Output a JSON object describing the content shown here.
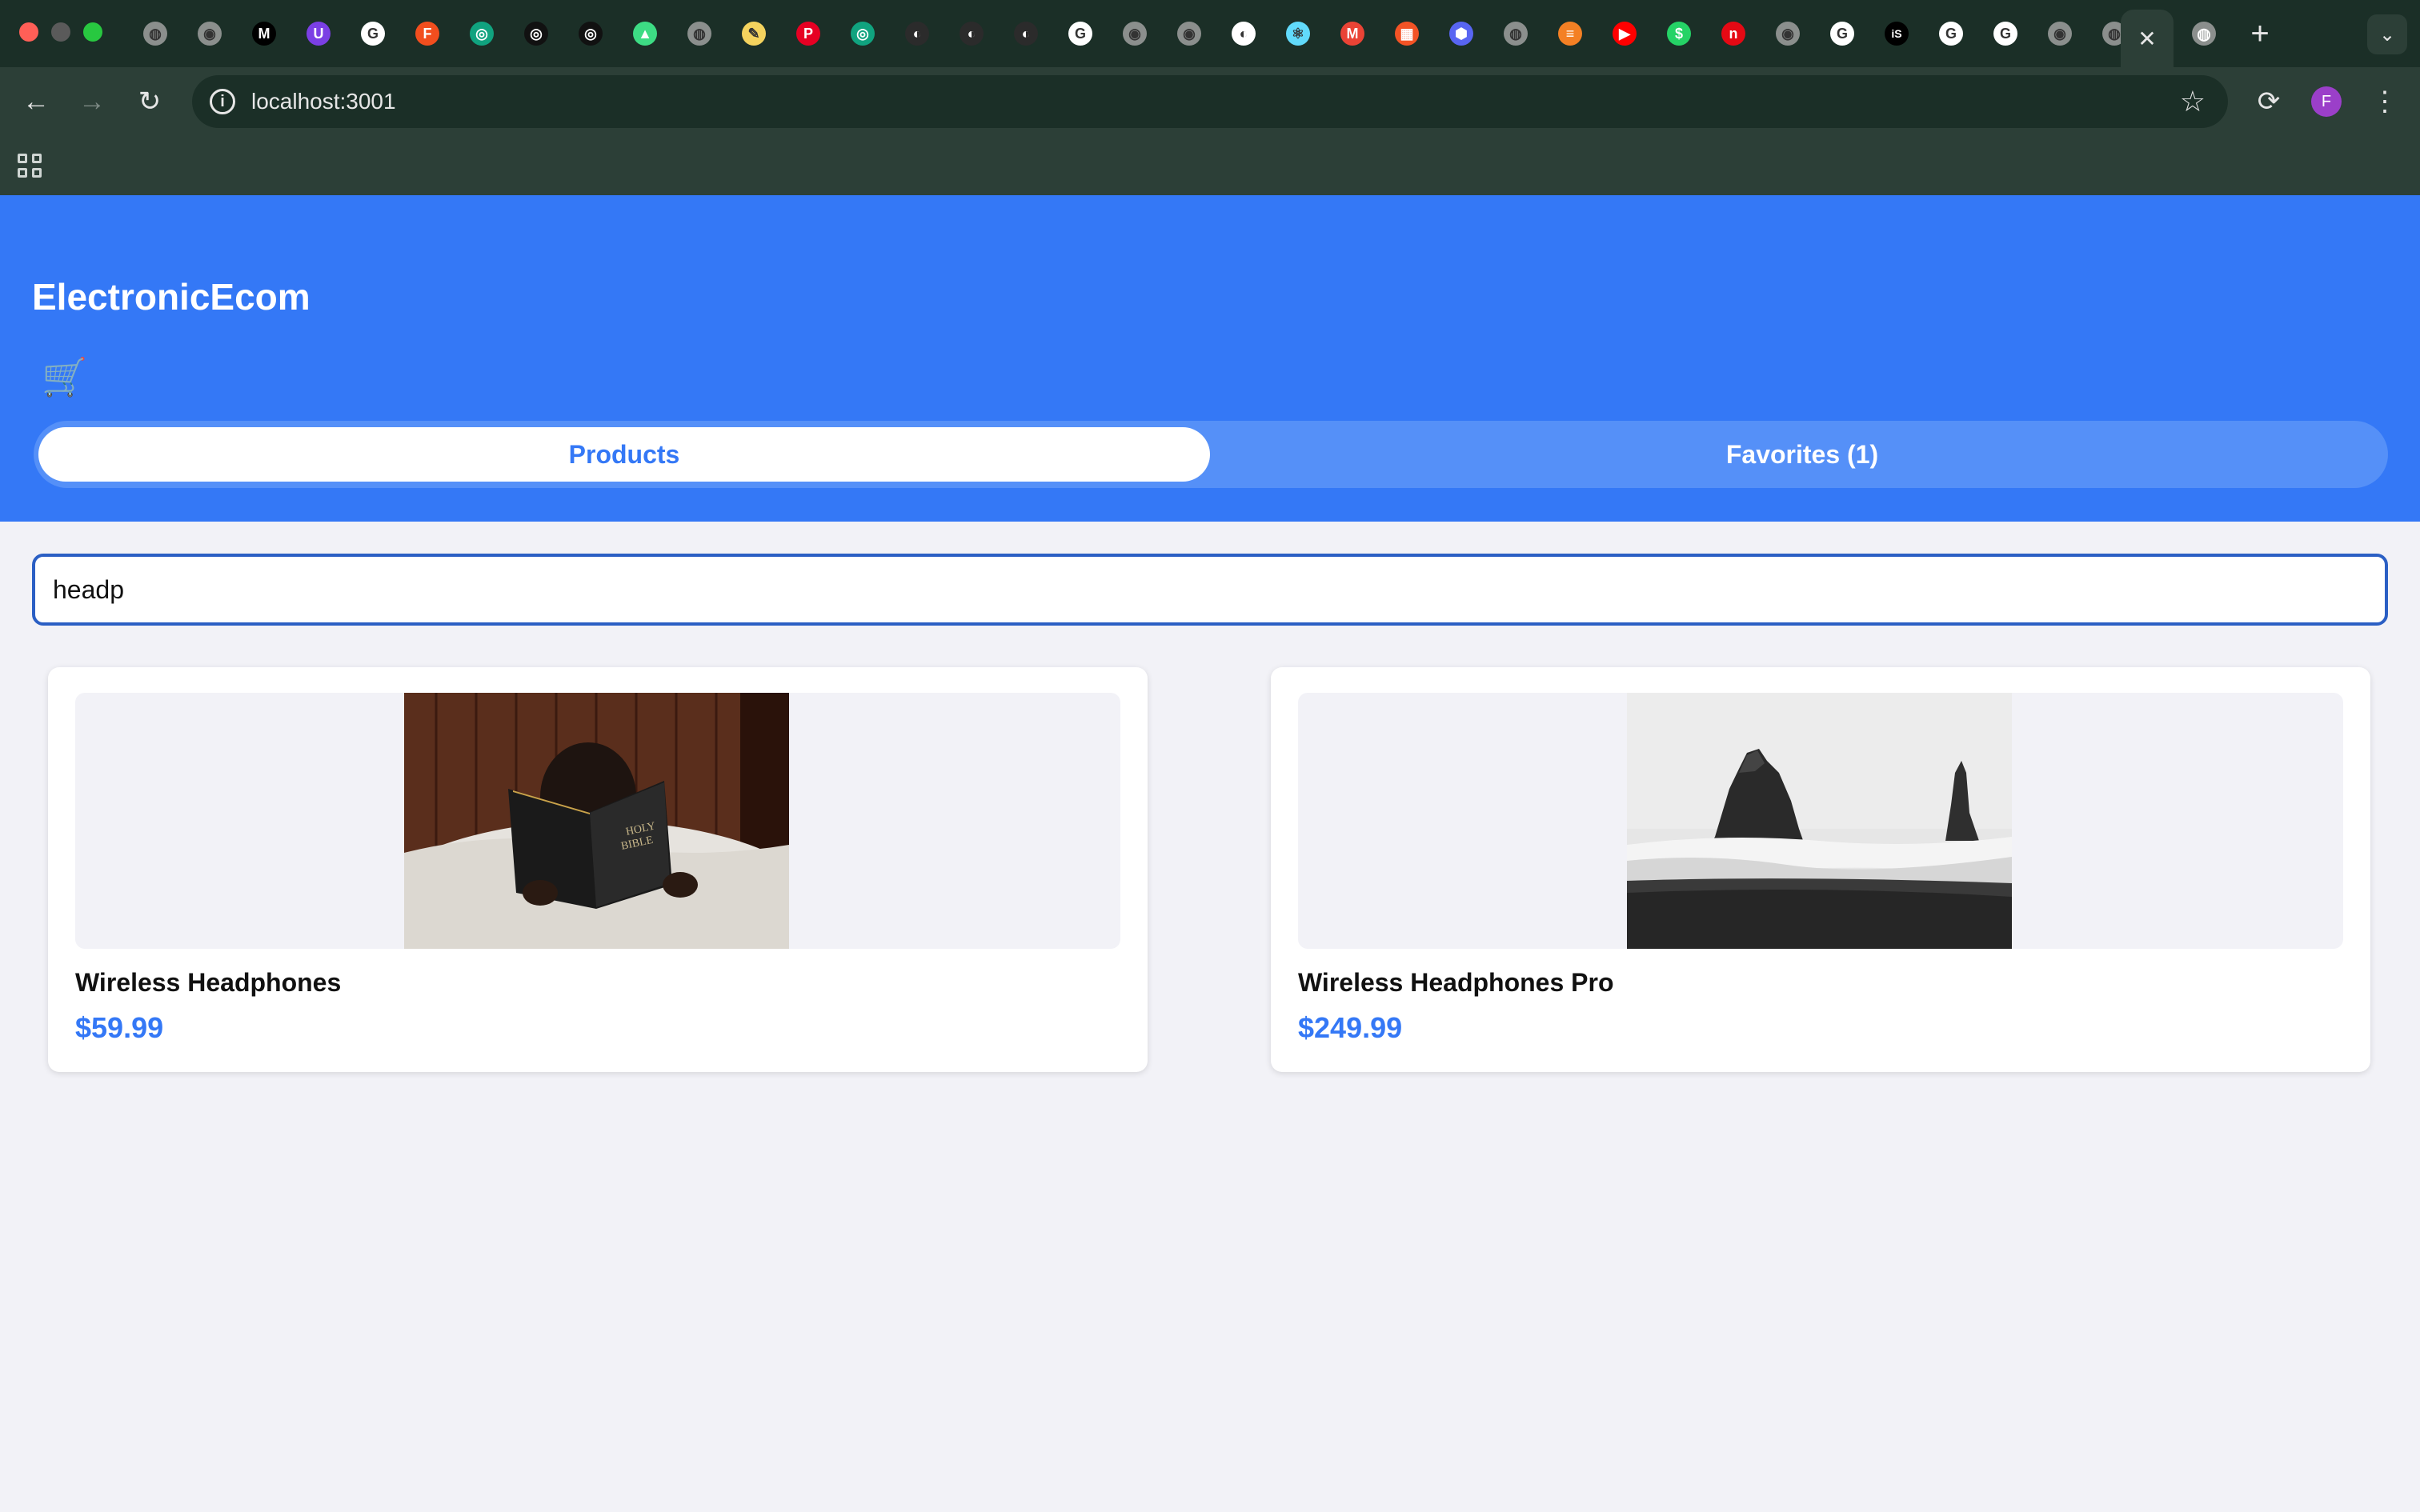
{
  "browser": {
    "url": "localhost:3001",
    "tab_close_glyph": "✕",
    "new_tab_glyph": "+",
    "avatar_initial": "F",
    "tab_favicons": [
      {
        "icon": "globe-icon",
        "glyph": "◍",
        "color": "#8b8f8d"
      },
      {
        "icon": "chrome-icon",
        "glyph": "◉",
        "color": "#8b8f8d"
      },
      {
        "icon": "medium-icon",
        "glyph": "M",
        "color": "#000000"
      },
      {
        "icon": "u-icon",
        "glyph": "U",
        "color": "#7b3fe4"
      },
      {
        "icon": "google-icon",
        "glyph": "G",
        "color": "#ffffff"
      },
      {
        "icon": "figma-icon",
        "glyph": "F",
        "color": "#f24e1e"
      },
      {
        "icon": "openai-icon",
        "glyph": "◎",
        "color": "#10a37f"
      },
      {
        "icon": "openai-icon",
        "glyph": "◎",
        "color": "#111111"
      },
      {
        "icon": "openai-icon",
        "glyph": "◎",
        "color": "#111111"
      },
      {
        "icon": "android-icon",
        "glyph": "▲",
        "color": "#3ddc84"
      },
      {
        "icon": "globe-icon",
        "glyph": "◍",
        "color": "#8b8f8d"
      },
      {
        "icon": "notes-icon",
        "glyph": "✎",
        "color": "#f4d35e"
      },
      {
        "icon": "pinterest-icon",
        "glyph": "P",
        "color": "#e60023"
      },
      {
        "icon": "openai-icon",
        "glyph": "◎",
        "color": "#10a37f"
      },
      {
        "icon": "github-icon",
        "glyph": "◐",
        "color": "#2b2b2b"
      },
      {
        "icon": "github-icon",
        "glyph": "◐",
        "color": "#2b2b2b"
      },
      {
        "icon": "github-icon",
        "glyph": "◐",
        "color": "#2b2b2b"
      },
      {
        "icon": "google-icon",
        "glyph": "G",
        "color": "#ffffff"
      },
      {
        "icon": "chrome-icon",
        "glyph": "◉",
        "color": "#8b8f8d"
      },
      {
        "icon": "chrome-icon",
        "glyph": "◉",
        "color": "#8b8f8d"
      },
      {
        "icon": "github-icon",
        "glyph": "◐",
        "color": "#ffffff"
      },
      {
        "icon": "react-icon",
        "glyph": "⚛",
        "color": "#61dafb"
      },
      {
        "icon": "gmail-icon",
        "glyph": "M",
        "color": "#ea4335"
      },
      {
        "icon": "microsoft-icon",
        "glyph": "▦",
        "color": "#f35325"
      },
      {
        "icon": "hexagon-icon",
        "glyph": "⬢",
        "color": "#5865f2"
      },
      {
        "icon": "globe-icon",
        "glyph": "◍",
        "color": "#8b8f8d"
      },
      {
        "icon": "stackoverflow-icon",
        "glyph": "≡",
        "color": "#f48024"
      },
      {
        "icon": "youtube-icon",
        "glyph": "▶",
        "color": "#ff0000"
      },
      {
        "icon": "whatsapp-icon",
        "glyph": "$",
        "color": "#25d366"
      },
      {
        "icon": "n-icon",
        "glyph": "n",
        "color": "#e50914"
      },
      {
        "icon": "chrome-icon",
        "glyph": "◉",
        "color": "#8b8f8d"
      },
      {
        "icon": "google-icon",
        "glyph": "G",
        "color": "#ffffff"
      },
      {
        "icon": "is-icon",
        "glyph": "iS",
        "color": "#000000"
      },
      {
        "icon": "google-icon",
        "glyph": "G",
        "color": "#ffffff"
      },
      {
        "icon": "google-icon",
        "glyph": "G",
        "color": "#ffffff"
      },
      {
        "icon": "chrome-icon",
        "glyph": "◉",
        "color": "#8b8f8d"
      },
      {
        "icon": "globe-icon",
        "glyph": "◍",
        "color": "#8b8f8d"
      }
    ]
  },
  "app": {
    "title": "ElectronicEcom",
    "cart_icon": "shopping-cart-icon",
    "cart_glyph": "🛒",
    "tabs": [
      {
        "label": "Products",
        "active": true
      },
      {
        "label": "Favorites (1)",
        "active": false
      }
    ],
    "search": {
      "value": "headp"
    },
    "products": [
      {
        "name": "Wireless Headphones",
        "price": "$59.99",
        "image": "child-reading-bible-photo"
      },
      {
        "name": "Wireless Headphones Pro",
        "price": "$249.99",
        "image": "sea-stacks-beach-photo"
      }
    ]
  },
  "colors": {
    "header": "#3478f6",
    "accent": "#3478f6",
    "page_bg": "#f2f2f7",
    "chrome_dark": "#1b2f27",
    "chrome_mid": "#2c3f37"
  }
}
